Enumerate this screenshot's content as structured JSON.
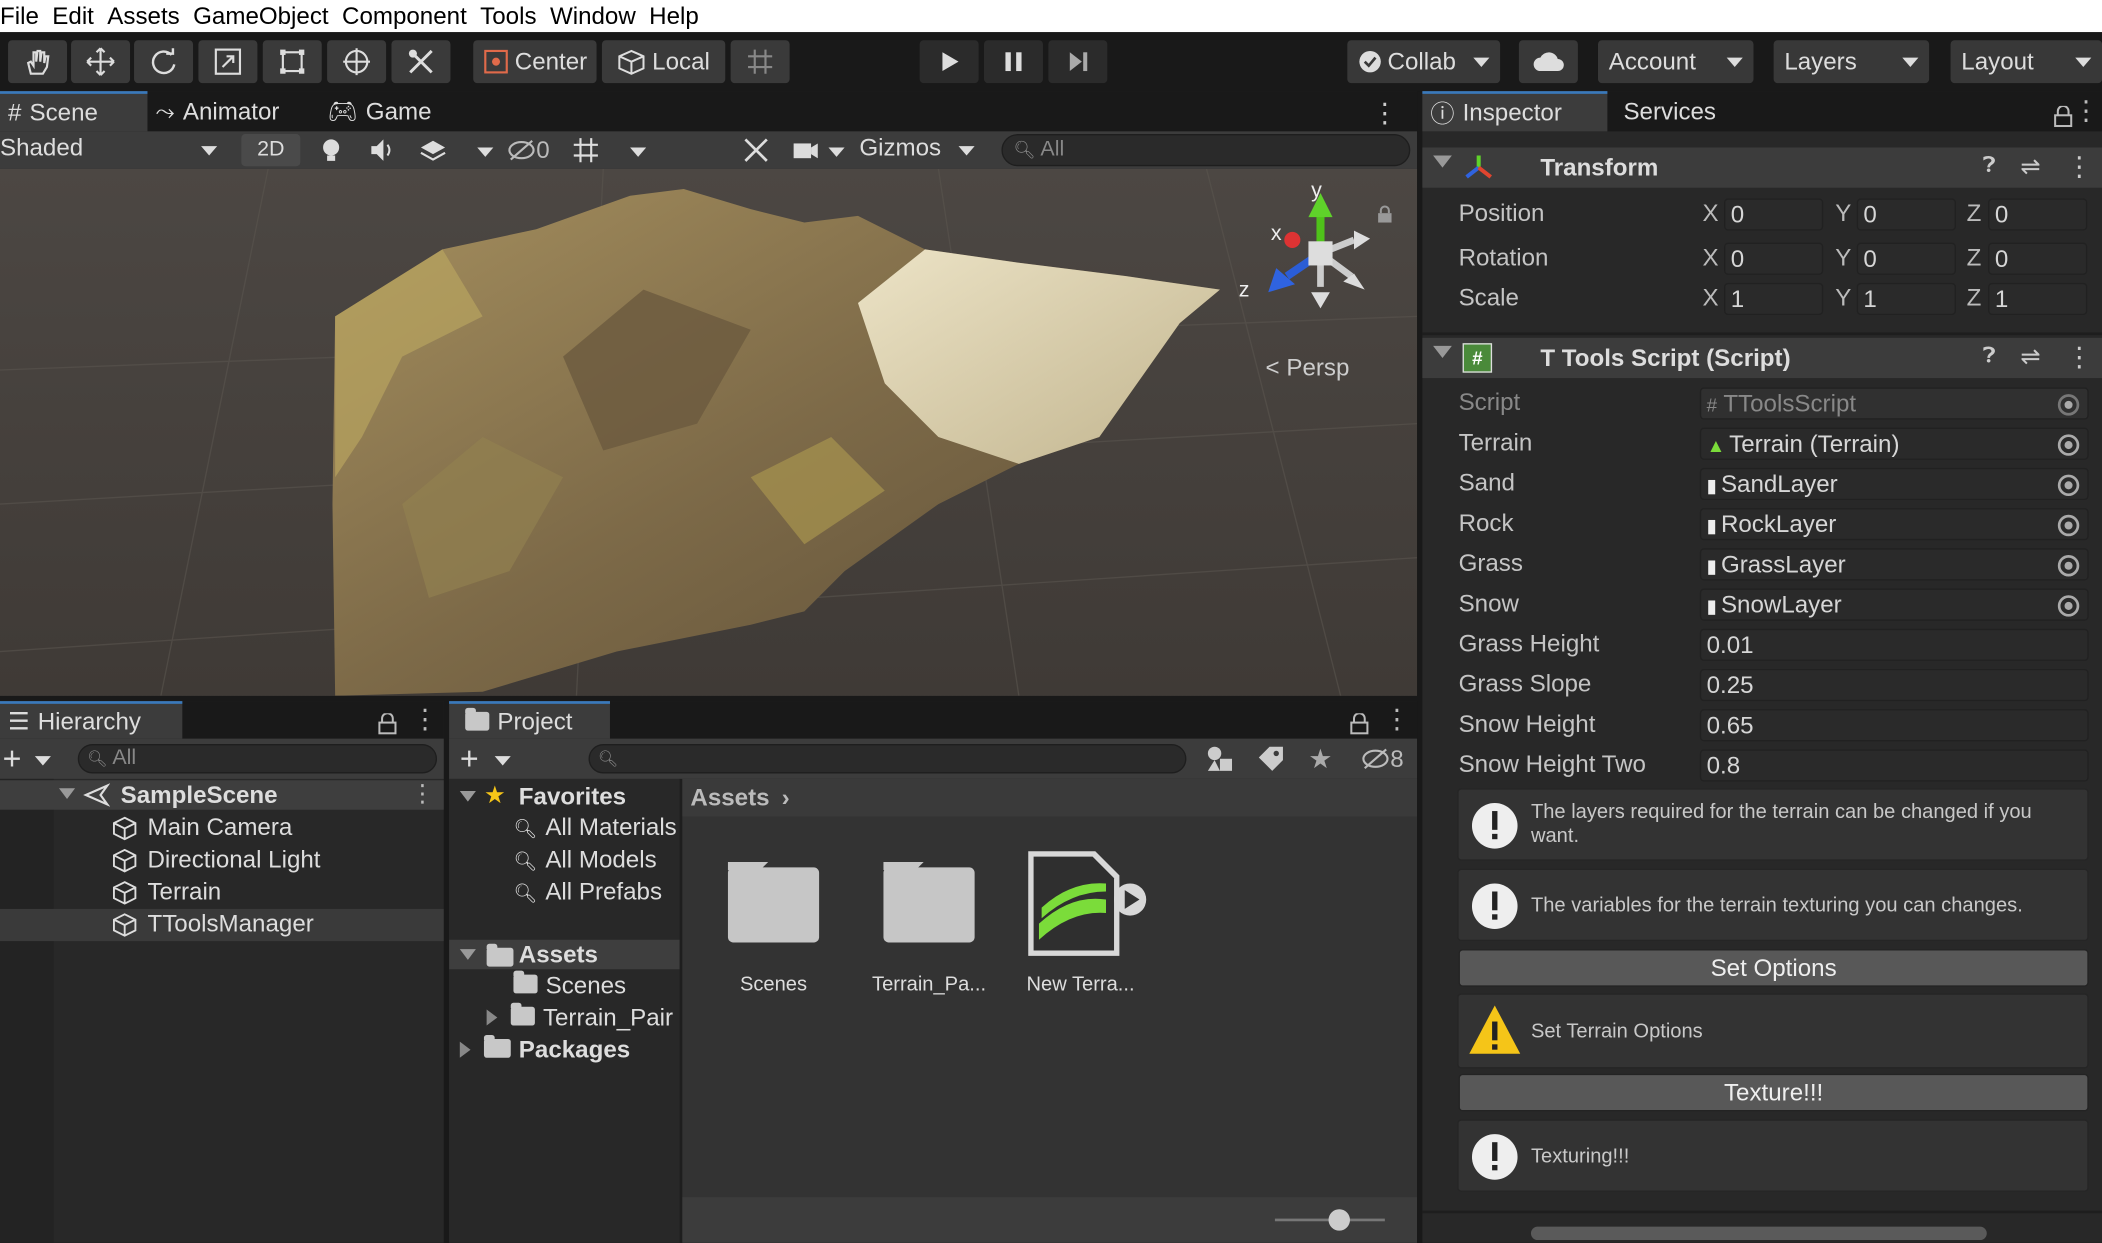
{
  "menu": [
    "File",
    "Edit",
    "Assets",
    "GameObject",
    "Component",
    "Tools",
    "Window",
    "Help"
  ],
  "toolbar": {
    "pivot_label": "Center",
    "space_label": "Local",
    "collab_label": "Collab",
    "account_label": "Account",
    "layers_label": "Layers",
    "layout_label": "Layout"
  },
  "scene_tabs": {
    "scene": "Scene",
    "animator": "Animator",
    "game": "Game"
  },
  "scene_toolbar": {
    "shading_mode": "Shaded",
    "mode_2d": "2D",
    "hidden_count": "0",
    "gizmos_label": "Gizmos",
    "search_placeholder": "All"
  },
  "scene_view": {
    "projection_label": "Persp",
    "axis_x": "x",
    "axis_y": "y",
    "axis_z": "z"
  },
  "inspector": {
    "tab_inspector": "Inspector",
    "tab_services": "Services",
    "transform": {
      "title": "Transform",
      "rows": [
        {
          "label": "Position",
          "x": "0",
          "y": "0",
          "z": "0"
        },
        {
          "label": "Rotation",
          "x": "0",
          "y": "0",
          "z": "0"
        },
        {
          "label": "Scale",
          "x": "1",
          "y": "1",
          "z": "1"
        }
      ],
      "axis_labels": [
        "X",
        "Y",
        "Z"
      ]
    },
    "script_component": {
      "title": "T Tools Script (Script)",
      "script_label": "Script",
      "script_value": "TToolsScript",
      "object_fields": [
        {
          "label": "Terrain",
          "value": "Terrain (Terrain)"
        },
        {
          "label": "Sand",
          "value": "SandLayer"
        },
        {
          "label": "Rock",
          "value": "RockLayer"
        },
        {
          "label": "Grass",
          "value": "GrassLayer"
        },
        {
          "label": "Snow",
          "value": "SnowLayer"
        }
      ],
      "float_fields": [
        {
          "label": "Grass Height",
          "value": "0.01"
        },
        {
          "label": "Grass Slope",
          "value": "0.25"
        },
        {
          "label": "Snow Height",
          "value": "0.65"
        },
        {
          "label": "Snow Height Two",
          "value": "0.8"
        }
      ],
      "help_layers": "The layers required for the terrain can be changed if you want.",
      "help_variables": "The variables for the terrain texturing you can changes.",
      "set_options_button": "Set Options",
      "warning_set_options": "Set Terrain Options",
      "texture_button": "Texture!!!",
      "help_texturing": "Texturing!!!"
    }
  },
  "hierarchy": {
    "title": "Hierarchy",
    "search_placeholder": "All",
    "scene_name": "SampleScene",
    "items": [
      "Main Camera",
      "Directional Light",
      "Terrain",
      "TToolsManager"
    ]
  },
  "project": {
    "title": "Project",
    "hidden_count": "8",
    "favorites_label": "Favorites",
    "favorites": [
      "All Materials",
      "All Models",
      "All Prefabs"
    ],
    "assets_label": "Assets",
    "asset_folders": [
      "Scenes",
      "Terrain_Pair"
    ],
    "packages_label": "Packages",
    "breadcrumb": "Assets",
    "grid_items": [
      "Scenes",
      "Terrain_Pa...",
      "New Terra..."
    ]
  },
  "colors": {
    "accent": "#3a79bb",
    "panel": "#282828",
    "field": "#2a2a2a",
    "button": "#585858"
  }
}
